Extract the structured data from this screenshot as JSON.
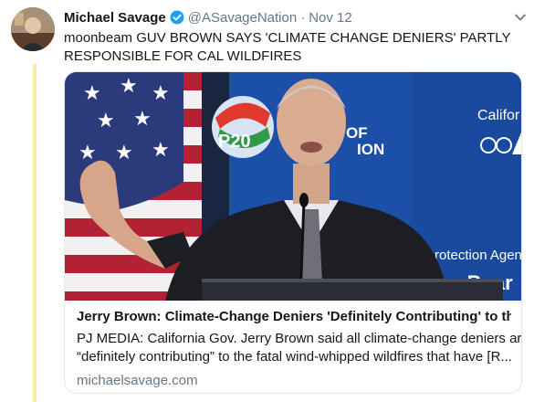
{
  "tweet": {
    "author_name": "Michael Savage",
    "handle": "@ASavageNation",
    "separator": "·",
    "date": "Nov 12",
    "text_lines": [
      "moonbeam GUV BROWN SAYS 'CLIMATE CHANGE DENIERS'  PARTLY",
      "RESPONSIBLE FOR CAL WILDFIRES"
    ],
    "verified": true
  },
  "card": {
    "image_text": {
      "banner_right": "Califor",
      "center_partial_1": "S OF",
      "center_partial_2": "ION",
      "lower_right_1": "rotection Agenc",
      "lower_right_2": "es Boar"
    },
    "title": "Jerry Brown: Climate-Change Deniers 'Definitely Contributing' to the...",
    "description_lines": [
      "PJ MEDIA: California Gov. Jerry Brown said all climate-change deniers are",
      "“definitely contributing” to the fatal wind-whipped wildfires that have [R..."
    ],
    "domain": "michaelsavage.com"
  },
  "icons": {
    "verified": "verified-badge-icon",
    "caret": "chevron-down-icon"
  },
  "colors": {
    "verified_blue": "#1da1f2",
    "thread_line": "#fbeba5",
    "secondary_text": "#657786",
    "banner_blue": "#1c4fa8"
  }
}
